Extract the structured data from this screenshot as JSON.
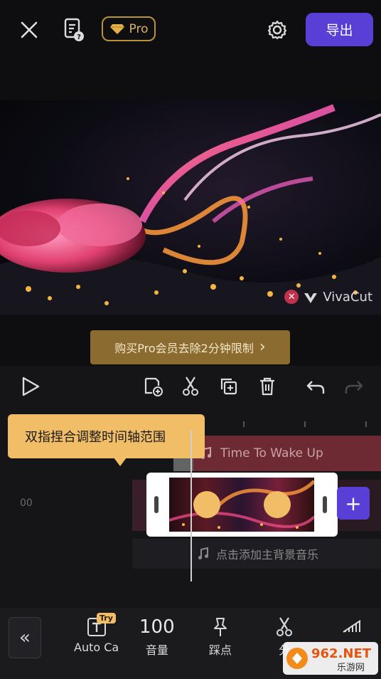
{
  "topbar": {
    "close_icon": "close-icon",
    "doc_icon": "document-help-icon",
    "pro_label": "Pro",
    "settings_icon": "gear-icon",
    "export_label": "导出"
  },
  "preview": {
    "watermark_text": "VivaCut"
  },
  "promo": {
    "buy_label": "购买Pro会员去除2分钟限制",
    "chevron": "›"
  },
  "editor": {
    "tooltip_text": "双指捏合调整时间轴范围",
    "music_track_title": "Time To Wake Up",
    "time_label": "00",
    "bgm_placeholder": "点击添加主背景音乐",
    "add_clip_symbol": "+"
  },
  "bottombar": {
    "collapse_symbol": "«",
    "items": [
      {
        "label": "Auto Ca",
        "icon": "text-caption-icon",
        "tag": "Try"
      },
      {
        "label": "音量",
        "value": "100"
      },
      {
        "label": "踩点",
        "icon": "pin-icon"
      },
      {
        "label": "分",
        "icon": "split-icon"
      },
      {
        "label": "",
        "icon": "signal-icon"
      }
    ]
  },
  "site_logo": {
    "text_main": "962.NET",
    "text_sub": "乐游网"
  },
  "colors": {
    "accent_purple": "#5a3fd6",
    "gold": "#f1bd67",
    "promo_gold": "#8b6b2f"
  }
}
